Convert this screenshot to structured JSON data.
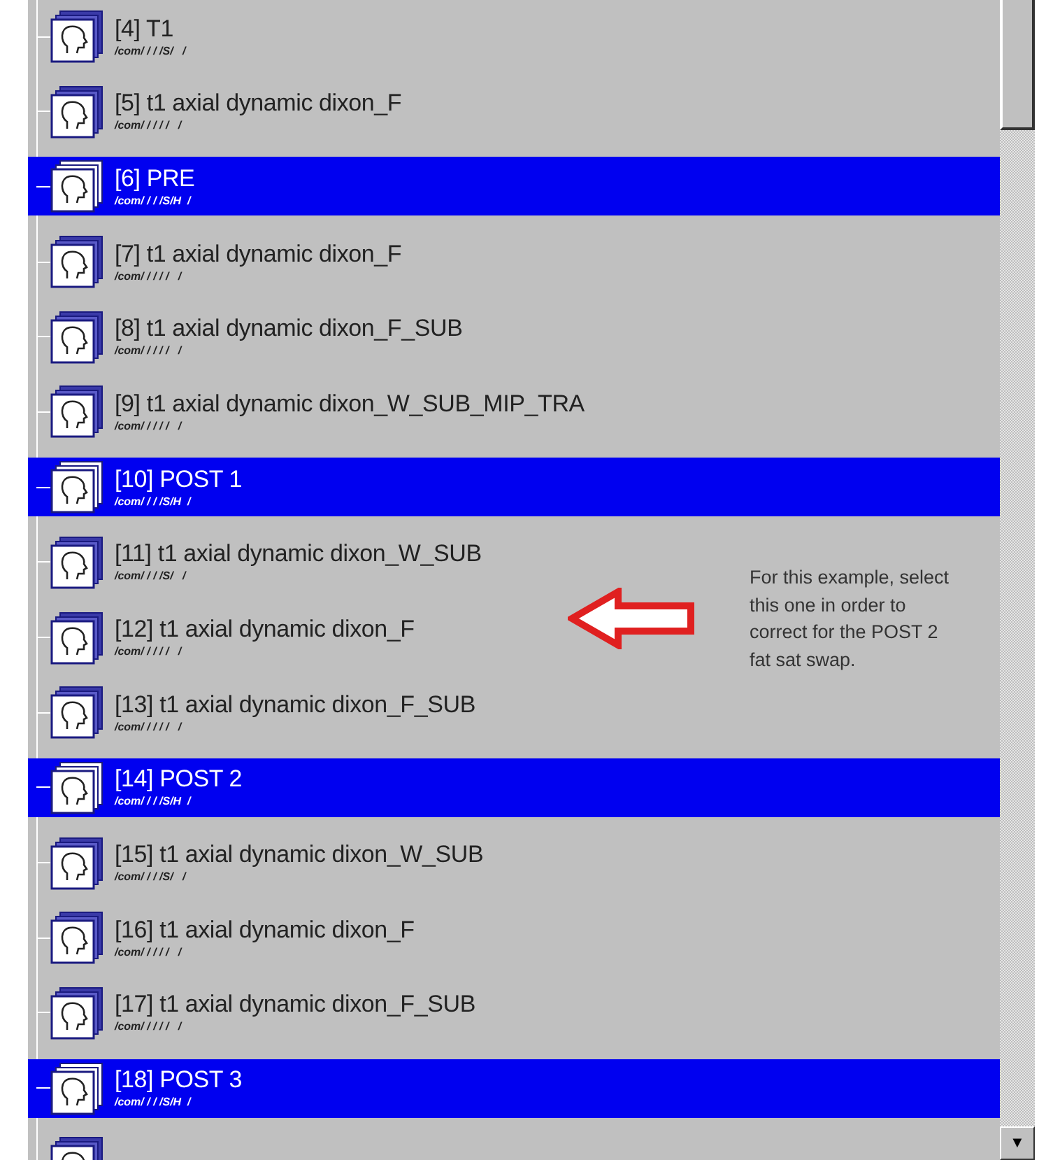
{
  "series_list": [
    {
      "title": "[4] T1",
      "path": "/com/ / / /S/   /",
      "selected": false
    },
    {
      "title": "[5] t1 axial dynamic dixon_F",
      "path": "/com/ / / / /   /",
      "selected": false
    },
    {
      "title": "[6] PRE",
      "path": "/com/ / / /S/H  /",
      "selected": true
    },
    {
      "title": "[7] t1 axial dynamic dixon_F",
      "path": "/com/ / / / /   /",
      "selected": false
    },
    {
      "title": "[8] t1 axial dynamic dixon_F_SUB",
      "path": "/com/ / / / /   /",
      "selected": false
    },
    {
      "title": "[9] t1 axial dynamic dixon_W_SUB_MIP_TRA",
      "path": "/com/ / / / /   /",
      "selected": false
    },
    {
      "title": "[10] POST 1",
      "path": "/com/ / / /S/H  /",
      "selected": true
    },
    {
      "title": "[11] t1 axial dynamic dixon_W_SUB",
      "path": "/com/ / / /S/   /",
      "selected": false
    },
    {
      "title": "[12] t1 axial dynamic dixon_F",
      "path": "/com/ / / / /   /",
      "selected": false
    },
    {
      "title": "[13] t1 axial dynamic dixon_F_SUB",
      "path": "/com/ / / / /   /",
      "selected": false
    },
    {
      "title": "[14] POST 2",
      "path": "/com/ / / /S/H  /",
      "selected": true
    },
    {
      "title": "[15] t1 axial dynamic dixon_W_SUB",
      "path": "/com/ / / /S/   /",
      "selected": false
    },
    {
      "title": "[16] t1 axial dynamic dixon_F",
      "path": "/com/ / / / /   /",
      "selected": false
    },
    {
      "title": "[17] t1 axial dynamic dixon_F_SUB",
      "path": "/com/ / / / /   /",
      "selected": false
    },
    {
      "title": "[18] POST 3",
      "path": "/com/ / / /S/H  /",
      "selected": true
    }
  ],
  "annotation": {
    "text": "For this example, select this one in order to correct for the POST 2 fat sat swap."
  },
  "scrollbar": {
    "down_arrow": "▼"
  }
}
